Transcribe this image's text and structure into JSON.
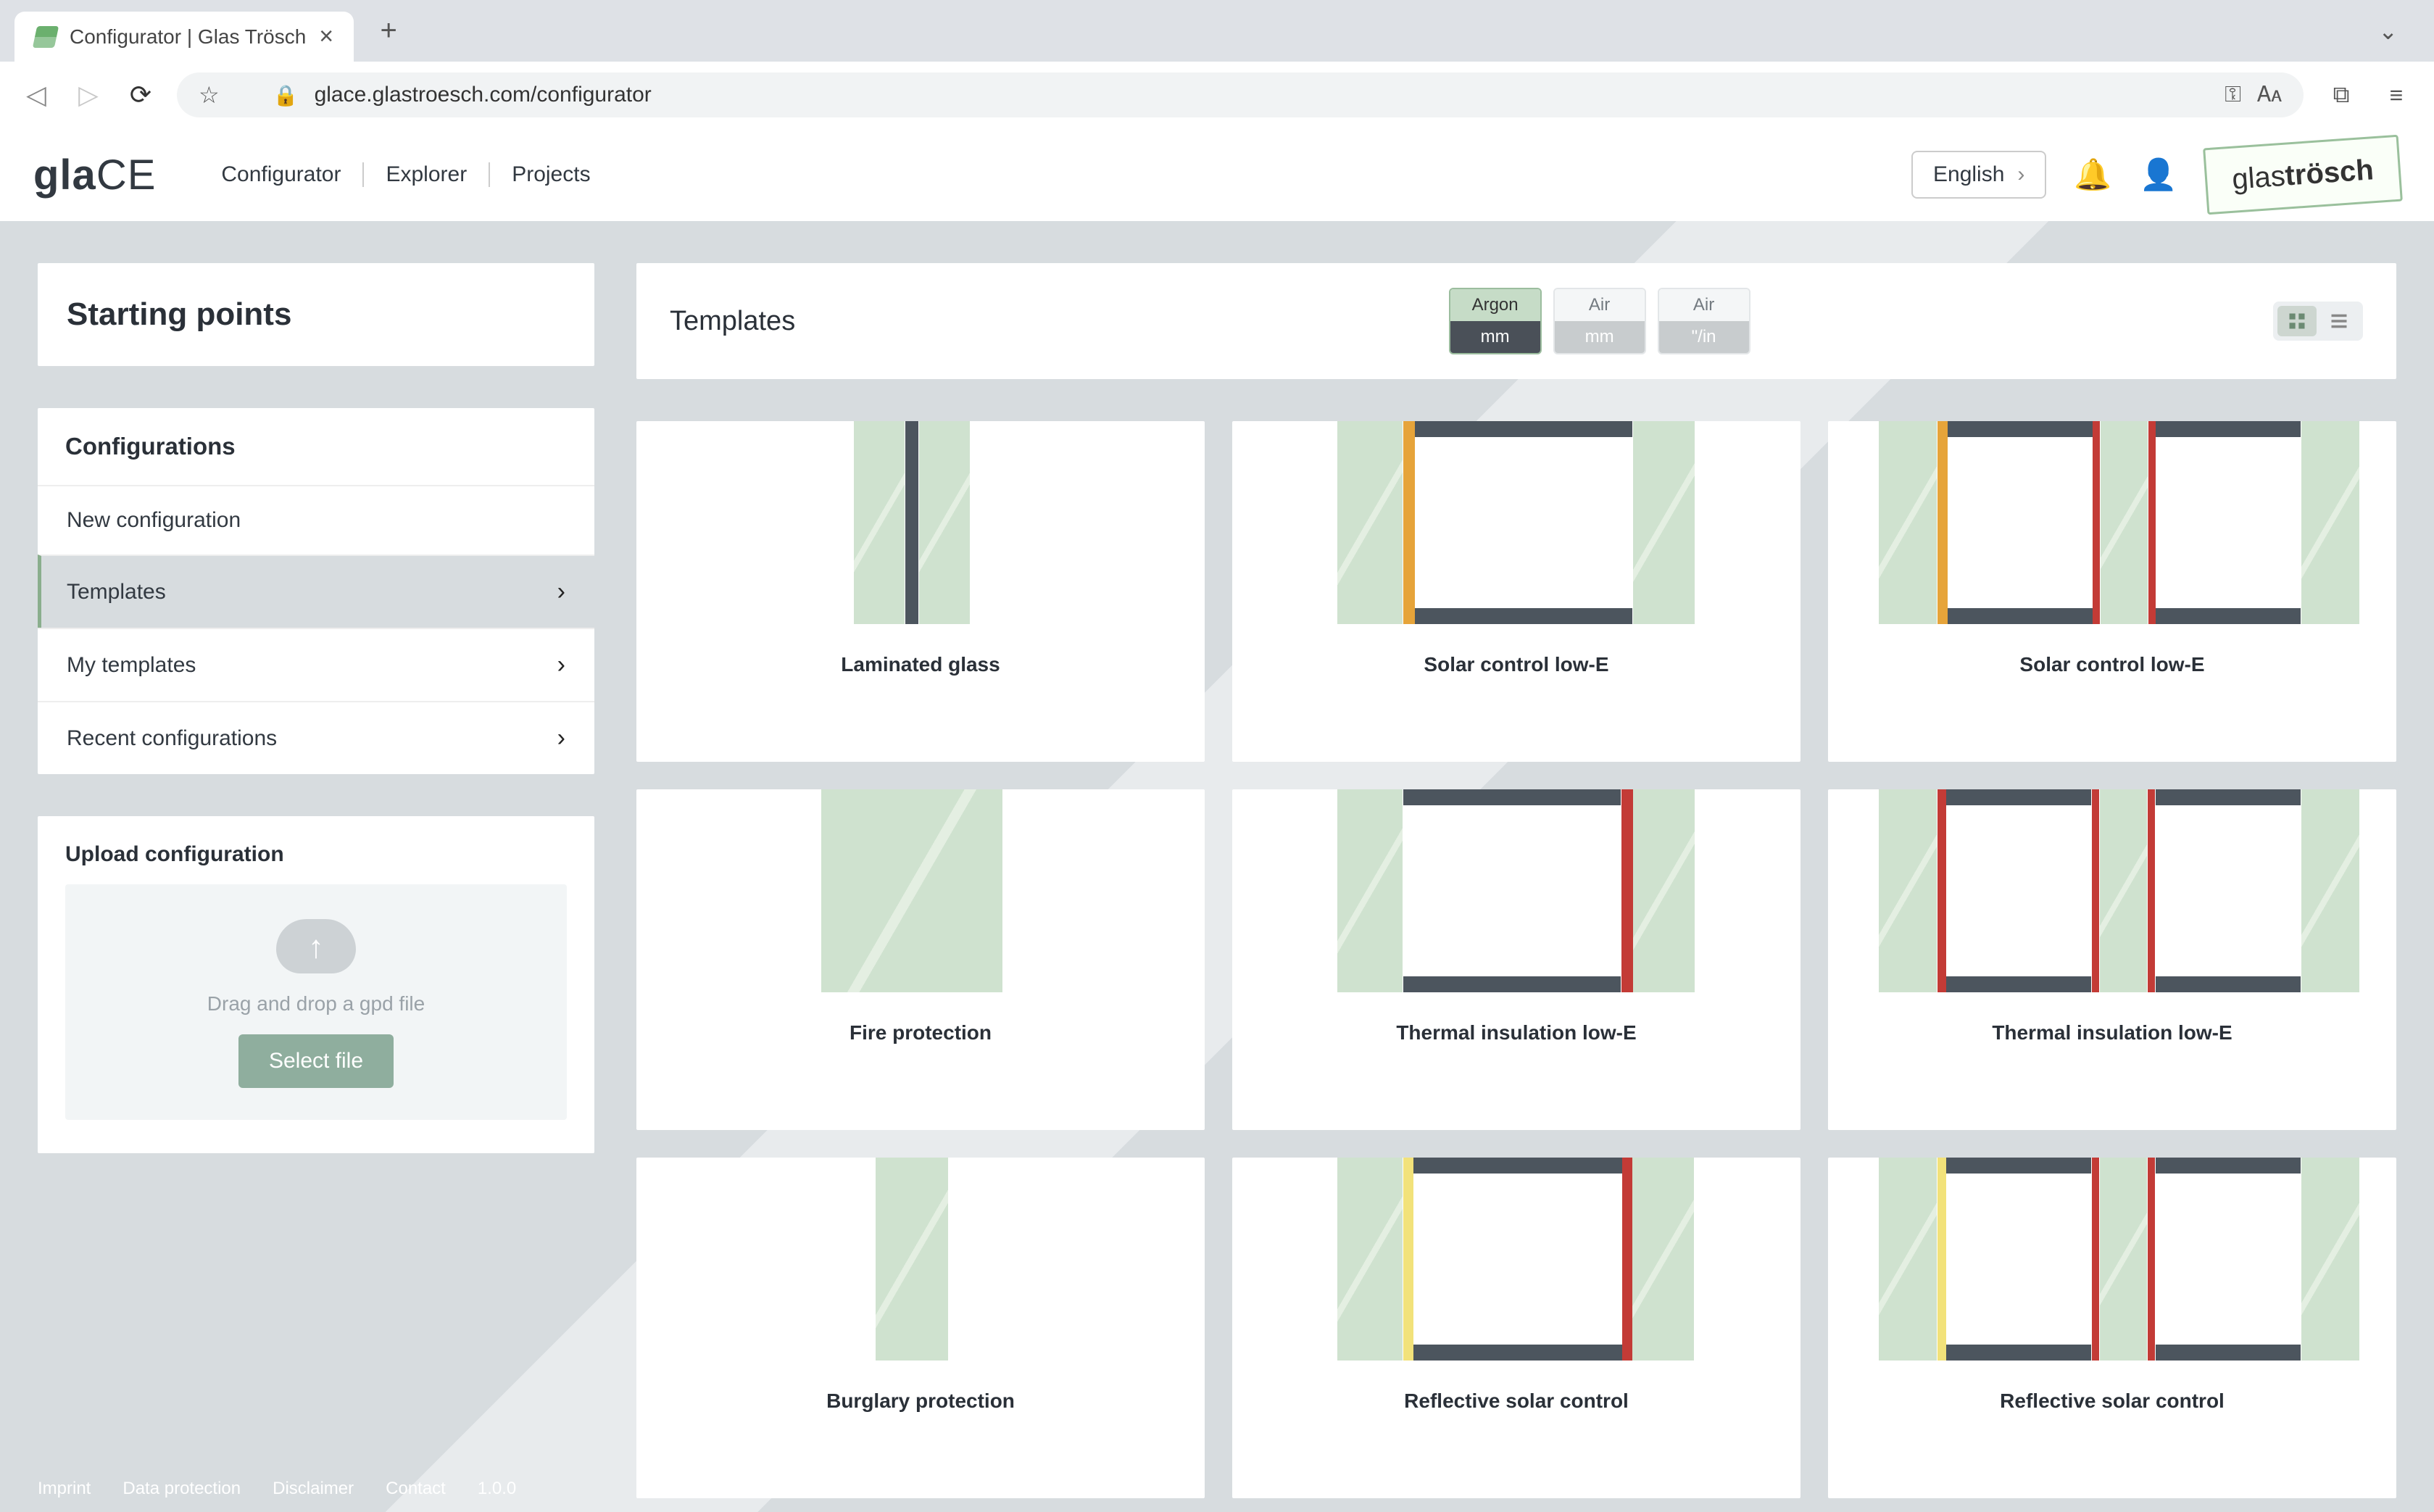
{
  "browser": {
    "tab_title": "Configurator | Glas Trösch",
    "url": "glace.glastroesch.com/configurator"
  },
  "app": {
    "brand_bold": "gla",
    "brand_light": "CE",
    "nav": [
      "Configurator",
      "Explorer",
      "Projects"
    ],
    "language": "English",
    "logo_light": "glas",
    "logo_bold": "trösch"
  },
  "sidebar": {
    "title": "Starting points",
    "config_title": "Configurations",
    "items": [
      {
        "label": "New configuration",
        "chevron": false,
        "active": false
      },
      {
        "label": "Templates",
        "chevron": true,
        "active": true
      },
      {
        "label": "My templates",
        "chevron": true,
        "active": false
      },
      {
        "label": "Recent configurations",
        "chevron": true,
        "active": false
      }
    ],
    "upload_title": "Upload configuration",
    "drop_text": "Drag and drop a gpd file",
    "select_file": "Select file"
  },
  "toolbar": {
    "section_title": "Templates",
    "segmented": [
      {
        "top": "Argon",
        "bot": "mm",
        "active": true
      },
      {
        "top": "Air",
        "bot": "mm",
        "active": false
      },
      {
        "top": "Air",
        "bot": "\"/in",
        "active": false
      }
    ]
  },
  "templates": [
    {
      "label": "Laminated glass",
      "kind": "laminated"
    },
    {
      "label": "Solar control low-E",
      "kind": "double-solar"
    },
    {
      "label": "Solar control low-E",
      "kind": "triple-solar"
    },
    {
      "label": "Fire protection",
      "kind": "fire"
    },
    {
      "label": "Thermal insulation low-E",
      "kind": "double-thermal"
    },
    {
      "label": "Thermal insulation low-E",
      "kind": "triple-thermal"
    },
    {
      "label": "Burglary protection",
      "kind": "burglary"
    },
    {
      "label": "Reflective solar control",
      "kind": "double-reflective"
    },
    {
      "label": "Reflective solar control",
      "kind": "triple-reflective"
    }
  ],
  "footer": {
    "links": [
      "Imprint",
      "Data protection",
      "Disclaimer",
      "Contact"
    ],
    "version": "1.0.0"
  }
}
